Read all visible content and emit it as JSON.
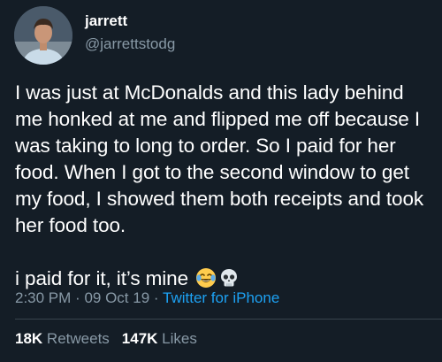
{
  "author": {
    "display_name": "jarrett",
    "handle": "@jarrettstodg",
    "avatar_icon": "profile-photo"
  },
  "tweet": {
    "text_paragraph_1": "I was just at McDonalds and this lady behind me honked at me and flipped me off because I was taking to long to order. So I paid for her food. When I got to the second window to get my food, I showed them both receipts and took her food too.",
    "text_paragraph_2": "i paid for it, it’s mine",
    "emojis": [
      "face-with-tears-of-joy-icon",
      "skull-icon"
    ]
  },
  "meta": {
    "time": "2:30 PM",
    "separator": "·",
    "date": "09 Oct 19",
    "source": "Twitter for iPhone"
  },
  "stats": {
    "retweets_count": "18K",
    "retweets_label": "Retweets",
    "likes_count": "147K",
    "likes_label": "Likes"
  },
  "colors": {
    "background": "#141d26",
    "text_primary": "#ffffff",
    "text_secondary": "#8899a6",
    "link": "#1da1f2",
    "divider": "#38444d"
  }
}
